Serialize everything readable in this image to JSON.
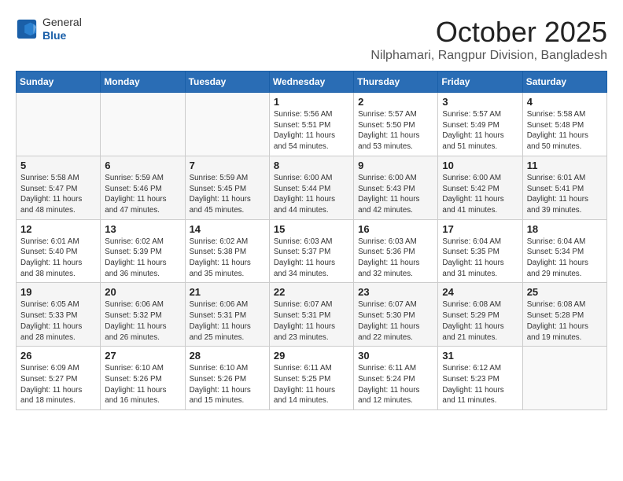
{
  "header": {
    "logo_line1": "General",
    "logo_line2": "Blue",
    "title": "October 2025",
    "subtitle": "Nilphamari, Rangpur Division, Bangladesh"
  },
  "days_of_week": [
    "Sunday",
    "Monday",
    "Tuesday",
    "Wednesday",
    "Thursday",
    "Friday",
    "Saturday"
  ],
  "weeks": [
    [
      {
        "day": "",
        "info": ""
      },
      {
        "day": "",
        "info": ""
      },
      {
        "day": "",
        "info": ""
      },
      {
        "day": "1",
        "info": "Sunrise: 5:56 AM\nSunset: 5:51 PM\nDaylight: 11 hours\nand 54 minutes."
      },
      {
        "day": "2",
        "info": "Sunrise: 5:57 AM\nSunset: 5:50 PM\nDaylight: 11 hours\nand 53 minutes."
      },
      {
        "day": "3",
        "info": "Sunrise: 5:57 AM\nSunset: 5:49 PM\nDaylight: 11 hours\nand 51 minutes."
      },
      {
        "day": "4",
        "info": "Sunrise: 5:58 AM\nSunset: 5:48 PM\nDaylight: 11 hours\nand 50 minutes."
      }
    ],
    [
      {
        "day": "5",
        "info": "Sunrise: 5:58 AM\nSunset: 5:47 PM\nDaylight: 11 hours\nand 48 minutes."
      },
      {
        "day": "6",
        "info": "Sunrise: 5:59 AM\nSunset: 5:46 PM\nDaylight: 11 hours\nand 47 minutes."
      },
      {
        "day": "7",
        "info": "Sunrise: 5:59 AM\nSunset: 5:45 PM\nDaylight: 11 hours\nand 45 minutes."
      },
      {
        "day": "8",
        "info": "Sunrise: 6:00 AM\nSunset: 5:44 PM\nDaylight: 11 hours\nand 44 minutes."
      },
      {
        "day": "9",
        "info": "Sunrise: 6:00 AM\nSunset: 5:43 PM\nDaylight: 11 hours\nand 42 minutes."
      },
      {
        "day": "10",
        "info": "Sunrise: 6:00 AM\nSunset: 5:42 PM\nDaylight: 11 hours\nand 41 minutes."
      },
      {
        "day": "11",
        "info": "Sunrise: 6:01 AM\nSunset: 5:41 PM\nDaylight: 11 hours\nand 39 minutes."
      }
    ],
    [
      {
        "day": "12",
        "info": "Sunrise: 6:01 AM\nSunset: 5:40 PM\nDaylight: 11 hours\nand 38 minutes."
      },
      {
        "day": "13",
        "info": "Sunrise: 6:02 AM\nSunset: 5:39 PM\nDaylight: 11 hours\nand 36 minutes."
      },
      {
        "day": "14",
        "info": "Sunrise: 6:02 AM\nSunset: 5:38 PM\nDaylight: 11 hours\nand 35 minutes."
      },
      {
        "day": "15",
        "info": "Sunrise: 6:03 AM\nSunset: 5:37 PM\nDaylight: 11 hours\nand 34 minutes."
      },
      {
        "day": "16",
        "info": "Sunrise: 6:03 AM\nSunset: 5:36 PM\nDaylight: 11 hours\nand 32 minutes."
      },
      {
        "day": "17",
        "info": "Sunrise: 6:04 AM\nSunset: 5:35 PM\nDaylight: 11 hours\nand 31 minutes."
      },
      {
        "day": "18",
        "info": "Sunrise: 6:04 AM\nSunset: 5:34 PM\nDaylight: 11 hours\nand 29 minutes."
      }
    ],
    [
      {
        "day": "19",
        "info": "Sunrise: 6:05 AM\nSunset: 5:33 PM\nDaylight: 11 hours\nand 28 minutes."
      },
      {
        "day": "20",
        "info": "Sunrise: 6:06 AM\nSunset: 5:32 PM\nDaylight: 11 hours\nand 26 minutes."
      },
      {
        "day": "21",
        "info": "Sunrise: 6:06 AM\nSunset: 5:31 PM\nDaylight: 11 hours\nand 25 minutes."
      },
      {
        "day": "22",
        "info": "Sunrise: 6:07 AM\nSunset: 5:31 PM\nDaylight: 11 hours\nand 23 minutes."
      },
      {
        "day": "23",
        "info": "Sunrise: 6:07 AM\nSunset: 5:30 PM\nDaylight: 11 hours\nand 22 minutes."
      },
      {
        "day": "24",
        "info": "Sunrise: 6:08 AM\nSunset: 5:29 PM\nDaylight: 11 hours\nand 21 minutes."
      },
      {
        "day": "25",
        "info": "Sunrise: 6:08 AM\nSunset: 5:28 PM\nDaylight: 11 hours\nand 19 minutes."
      }
    ],
    [
      {
        "day": "26",
        "info": "Sunrise: 6:09 AM\nSunset: 5:27 PM\nDaylight: 11 hours\nand 18 minutes."
      },
      {
        "day": "27",
        "info": "Sunrise: 6:10 AM\nSunset: 5:26 PM\nDaylight: 11 hours\nand 16 minutes."
      },
      {
        "day": "28",
        "info": "Sunrise: 6:10 AM\nSunset: 5:26 PM\nDaylight: 11 hours\nand 15 minutes."
      },
      {
        "day": "29",
        "info": "Sunrise: 6:11 AM\nSunset: 5:25 PM\nDaylight: 11 hours\nand 14 minutes."
      },
      {
        "day": "30",
        "info": "Sunrise: 6:11 AM\nSunset: 5:24 PM\nDaylight: 11 hours\nand 12 minutes."
      },
      {
        "day": "31",
        "info": "Sunrise: 6:12 AM\nSunset: 5:23 PM\nDaylight: 11 hours\nand 11 minutes."
      },
      {
        "day": "",
        "info": ""
      }
    ]
  ]
}
